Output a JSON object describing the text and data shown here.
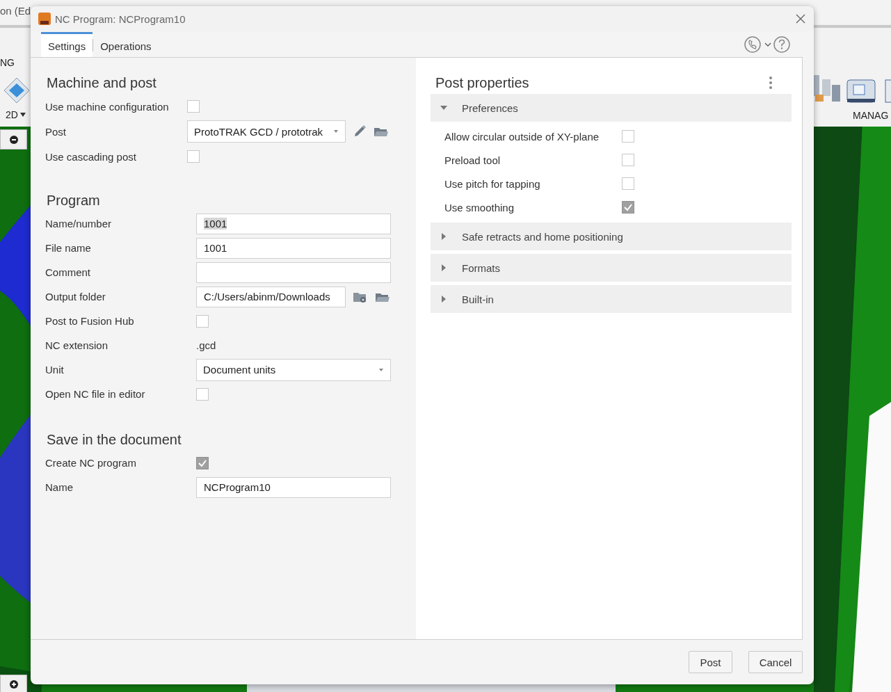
{
  "app_behind": {
    "title": "on (Ed",
    "tab": "NG",
    "mode_menu": "2D",
    "manage_label": "MANAG"
  },
  "dialog": {
    "title": "NC Program: NCProgram10",
    "tabs": [
      {
        "label": "Settings",
        "selected": true
      },
      {
        "label": "Operations",
        "selected": false
      }
    ],
    "settings": [
      {
        "heading": "Machine and post",
        "rows": [
          {
            "kind": "checkbox",
            "label": "Use machine configuration",
            "checked": false
          },
          {
            "kind": "post",
            "label": "Post",
            "value": "ProtoTRAK GCD / prototrak"
          },
          {
            "kind": "checkbox",
            "label": "Use cascading post",
            "checked": false
          }
        ]
      },
      {
        "heading": "Program",
        "rows": [
          {
            "kind": "text",
            "label": "Name/number",
            "value": "1001",
            "text_selected": true
          },
          {
            "kind": "text",
            "label": "File name",
            "value": "1001",
            "text_selected": false
          },
          {
            "kind": "text",
            "label": "Comment"
          },
          {
            "kind": "path",
            "label": "Output folder",
            "value": "C:/Users/abinm/Downloads"
          },
          {
            "kind": "checkbox",
            "label": "Post to Fusion Hub",
            "checked": false
          },
          {
            "kind": "static",
            "label": "NC extension",
            "value": ".gcd"
          },
          {
            "kind": "select",
            "label": "Unit",
            "value": "Document units"
          },
          {
            "kind": "checkbox",
            "label": "Open NC file in editor",
            "checked": false
          }
        ]
      },
      {
        "heading": "Save in the document",
        "rows": [
          {
            "kind": "checkbox",
            "label": "Create NC program",
            "checked": true
          },
          {
            "kind": "text",
            "label": "Name",
            "value": "NCProgram10",
            "text_selected": false
          }
        ]
      }
    ],
    "post_properties": {
      "heading": "Post properties",
      "groups": [
        {
          "title": "Preferences",
          "expanded": true,
          "rows": [
            {
              "label": "Allow circular outside of XY-plane",
              "checked": false
            },
            {
              "label": "Preload tool",
              "checked": false
            },
            {
              "label": "Use pitch for tapping",
              "checked": false
            },
            {
              "label": "Use smoothing",
              "checked": true
            }
          ]
        },
        {
          "title": "Safe retracts and home positioning",
          "expanded": false
        },
        {
          "title": "Formats",
          "expanded": false
        },
        {
          "title": "Built-in",
          "expanded": false
        }
      ]
    },
    "buttons": [
      "Post",
      "Cancel"
    ]
  }
}
